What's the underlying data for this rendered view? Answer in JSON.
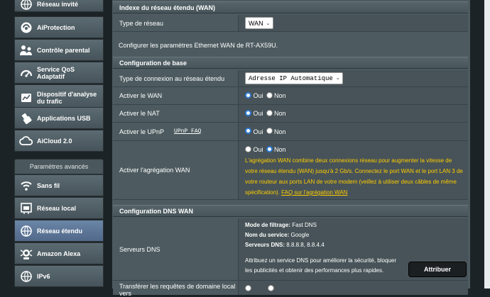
{
  "sidebar": {
    "items_top": [
      {
        "label": "Réseau invité",
        "icon": "guest-network-icon"
      },
      {
        "label": "AiProtection",
        "icon": "aiprotection-icon"
      },
      {
        "label": "Contrôle parental",
        "icon": "parental-control-icon"
      },
      {
        "label": "Service QoS Adaptatif",
        "icon": "qos-icon"
      },
      {
        "label": "Dispositif d'analyse du trafic",
        "icon": "traffic-analyzer-icon"
      },
      {
        "label": "Applications USB",
        "icon": "usb-icon"
      },
      {
        "label": "AiCloud 2.0",
        "icon": "aicloud-icon"
      }
    ],
    "advanced_header": "Paramètres avancés",
    "items_advanced": [
      {
        "label": "Sans fil",
        "icon": "wireless-icon"
      },
      {
        "label": "Réseau local",
        "icon": "lan-icon"
      },
      {
        "label": "Réseau étendu",
        "icon": "wan-icon",
        "active": true
      },
      {
        "label": "Amazon Alexa",
        "icon": "alexa-icon"
      },
      {
        "label": "IPv6",
        "icon": "ipv6-icon"
      }
    ]
  },
  "wan_index": {
    "header": "Indexe du réseau étendu (WAN)",
    "network_type_label": "Type de réseau",
    "network_type_value": "WAN"
  },
  "config_text": "Configurer les paramètres Ethernet WAN de RT-AX59U.",
  "basic": {
    "header": "Configuration de base",
    "connection_type_label": "Type de connexion au réseau étendu",
    "connection_type_value": "Adresse IP Automatique",
    "enable_wan_label": "Activer le WAN",
    "enable_nat_label": "Activer le NAT",
    "enable_upnp_label": "Activer le UPnP",
    "upnp_faq": "UPnP FAQ",
    "wan_aggregation_label": "Activer l'agrégation WAN",
    "yes": "Oui",
    "no": "Non",
    "aggregation_warning": "L'agrégation WAN combine deux connexions réseau pour augmenter la vitesse de votre réseau étendu (WAN) jusqu'à 2 Gb/s. Connectez le port WAN et le port LAN 3 de votre routeur aux ports LAN de votre modem (veillez à utiliser deux câbles de même spécification).",
    "aggregation_faq": "FAQ sur l'agrégation WAN"
  },
  "dns": {
    "header": "Configuration DNS WAN",
    "servers_label": "Serveurs DNS",
    "filter_mode_label": "Mode de filtrage:",
    "filter_mode_value": "Fast DNS",
    "service_name_label": "Nom du service:",
    "service_name_value": "Google",
    "dns_servers_label": "Serveurs DNS:",
    "dns_servers_value": "8.8.8.8, 8.8.4.4",
    "assign_text": "Attribuez un service DNS pour améliorer la sécurité, bloquer les publicités et obtenir des performances plus rapides.",
    "assign_button": "Attribuer",
    "forward_label": "Transférer les requêtes de domaine local vers"
  }
}
